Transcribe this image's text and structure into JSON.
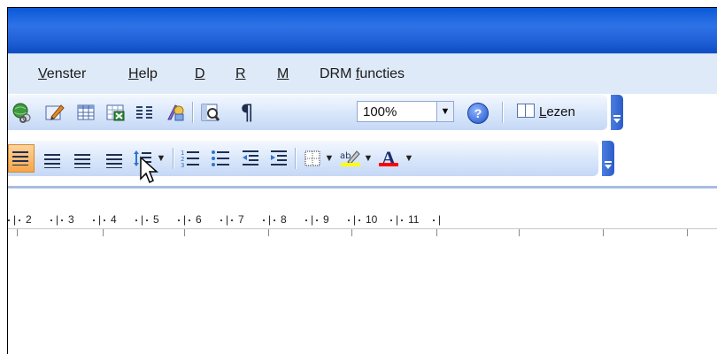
{
  "menu": {
    "items": [
      {
        "pre": "",
        "key": "V",
        "post": "enster"
      },
      {
        "pre": "",
        "key": "H",
        "post": "elp"
      },
      {
        "pre": "",
        "key": "D",
        "post": ""
      },
      {
        "pre": "",
        "key": "R",
        "post": ""
      },
      {
        "pre": "",
        "key": "M",
        "post": ""
      },
      {
        "pre": "DRM ",
        "key": "f",
        "post": "uncties"
      }
    ]
  },
  "standard_toolbar": {
    "zoom_value": "100%",
    "reading_button": {
      "pre": "",
      "key": "L",
      "post": "ezen"
    }
  },
  "ruler": {
    "numbers": [
      "2",
      "3",
      "4",
      "5",
      "6",
      "7",
      "8",
      "9",
      "10",
      "11"
    ]
  },
  "colors": {
    "highlight": "#ffff00",
    "font_color": "#ff0000",
    "titlebar": "#1f5fd6",
    "toolbar": "#dde9fb"
  }
}
